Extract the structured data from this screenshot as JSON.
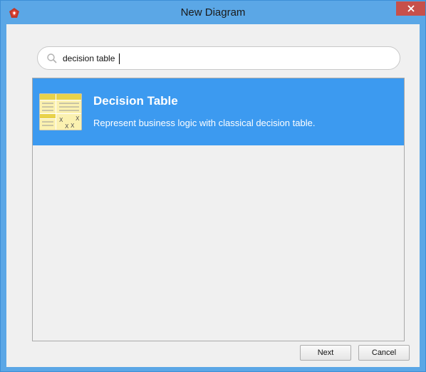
{
  "window": {
    "title": "New Diagram",
    "app_icon": "visual-paradigm-logo-icon",
    "close_icon": "close-icon"
  },
  "search": {
    "value": "decision table",
    "placeholder": "",
    "icon": "search-icon"
  },
  "results": [
    {
      "title": "Decision Table",
      "description": "Represent business logic with classical decision table.",
      "icon": "decision-table-thumbnail-icon",
      "selected": true
    }
  ],
  "buttons": {
    "next_label": "Next",
    "cancel_label": "Cancel"
  },
  "colors": {
    "titlebar": "#5ba7e6",
    "close_button": "#c7504a",
    "selection": "#3c9af0",
    "dialog_background": "#f0f0f0"
  }
}
